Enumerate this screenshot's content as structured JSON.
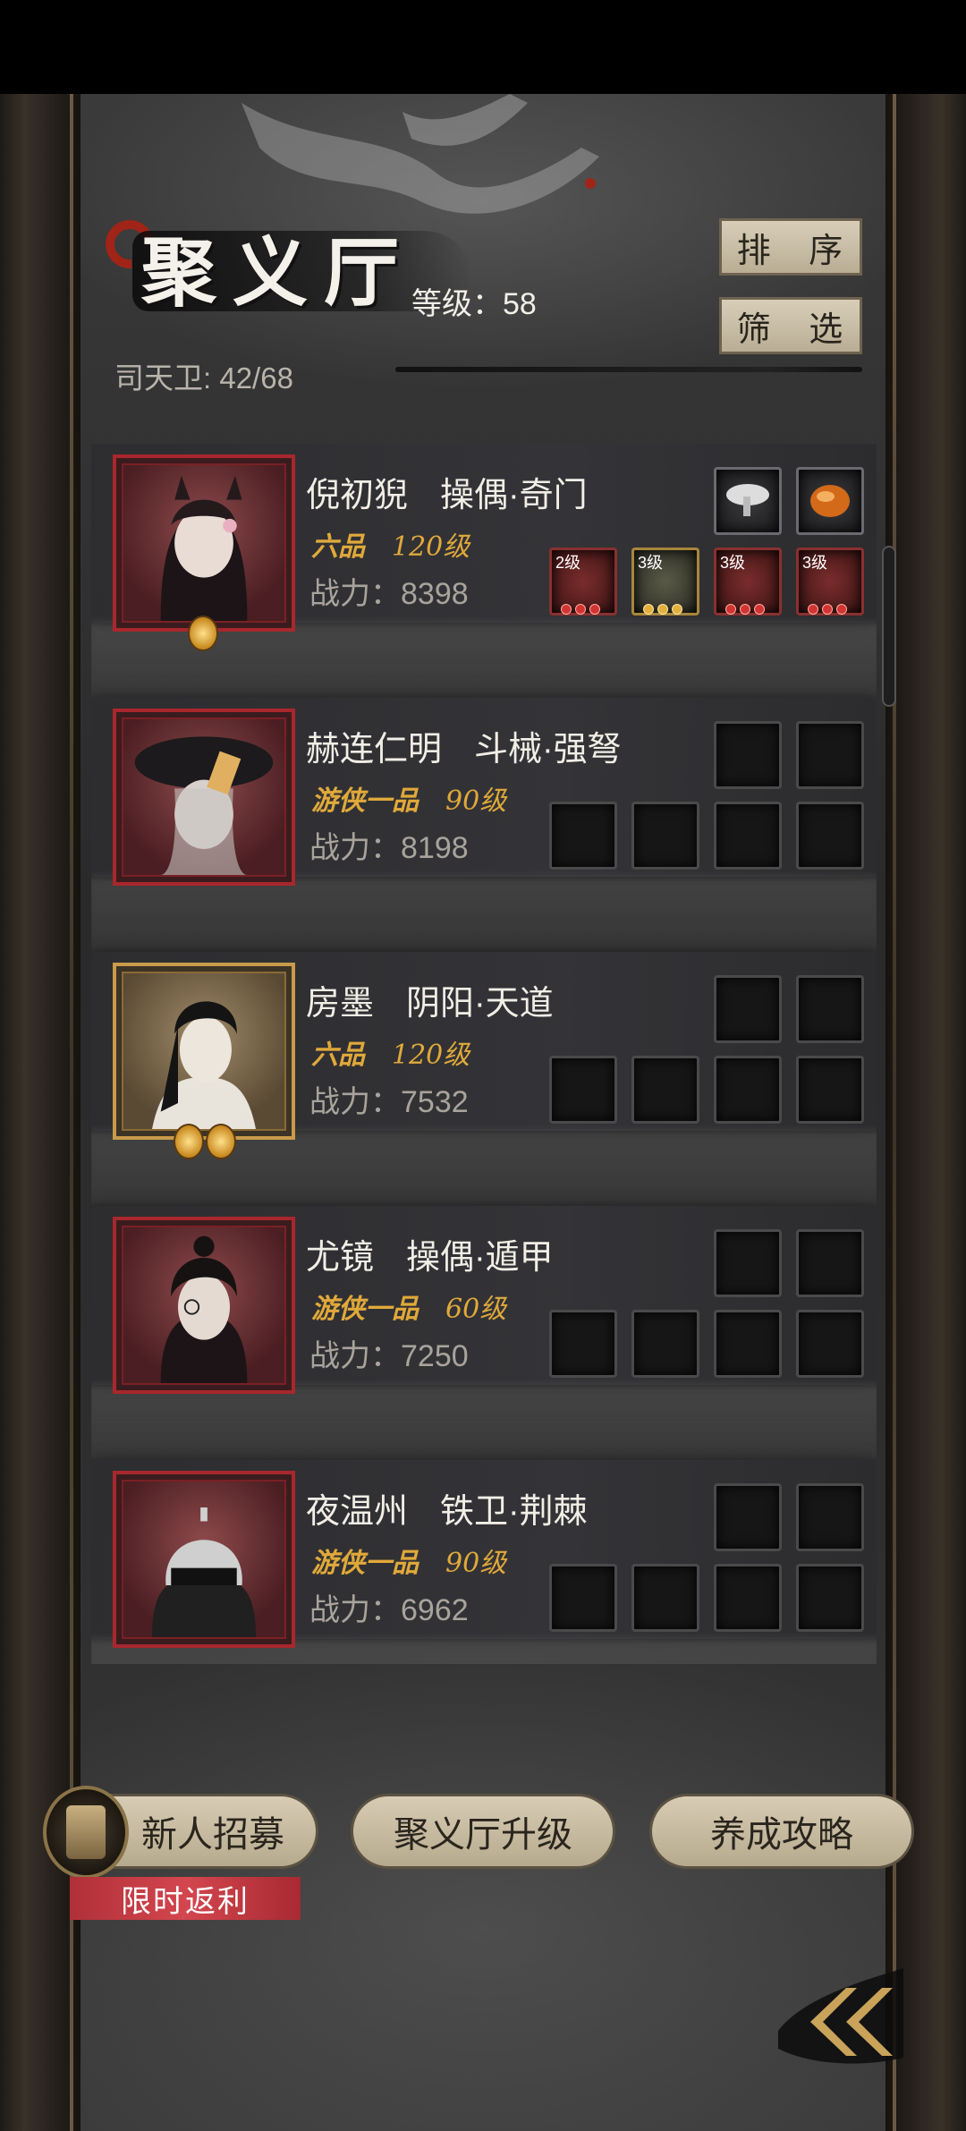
{
  "header": {
    "title": "聚义厅",
    "level_label": "等级：58",
    "count_label": "司天卫: 42/68",
    "sort_label": "排 序",
    "filter_label": "筛 选"
  },
  "heroes": [
    {
      "name": "倪初猊",
      "class": "操偶·奇门",
      "rank": "六品",
      "level": "120级",
      "power": "战力：8398",
      "equip_tags": [
        "2级",
        "3级",
        "3级",
        "3级"
      ]
    },
    {
      "name": "赫连仁明",
      "class": "斗械·强弩",
      "rank": "游侠一品",
      "level": "90级",
      "power": "战力：8198"
    },
    {
      "name": "房墨",
      "class": "阴阳·天道",
      "rank": "六品",
      "level": "120级",
      "power": "战力：7532"
    },
    {
      "name": "尤镜",
      "class": "操偶·遁甲",
      "rank": "游侠一品",
      "level": "60级",
      "power": "战力：7250"
    },
    {
      "name": "夜温州",
      "class": "铁卫·荆棘",
      "rank": "游侠一品",
      "level": "90级",
      "power": "战力：6962"
    }
  ],
  "footer": {
    "recruit_label": "新人招募",
    "upgrade_label": "聚义厅升级",
    "guide_label": "养成攻略",
    "promo_label": "限时返利"
  },
  "icons": {
    "back": "double-chevron-left-icon",
    "recruit": "card-deck-icon"
  },
  "colors": {
    "rank_gold": "#e0a93a",
    "portrait_red": "#a8272c",
    "portrait_gold": "#c89a4a",
    "promo_red": "#c23a42"
  }
}
